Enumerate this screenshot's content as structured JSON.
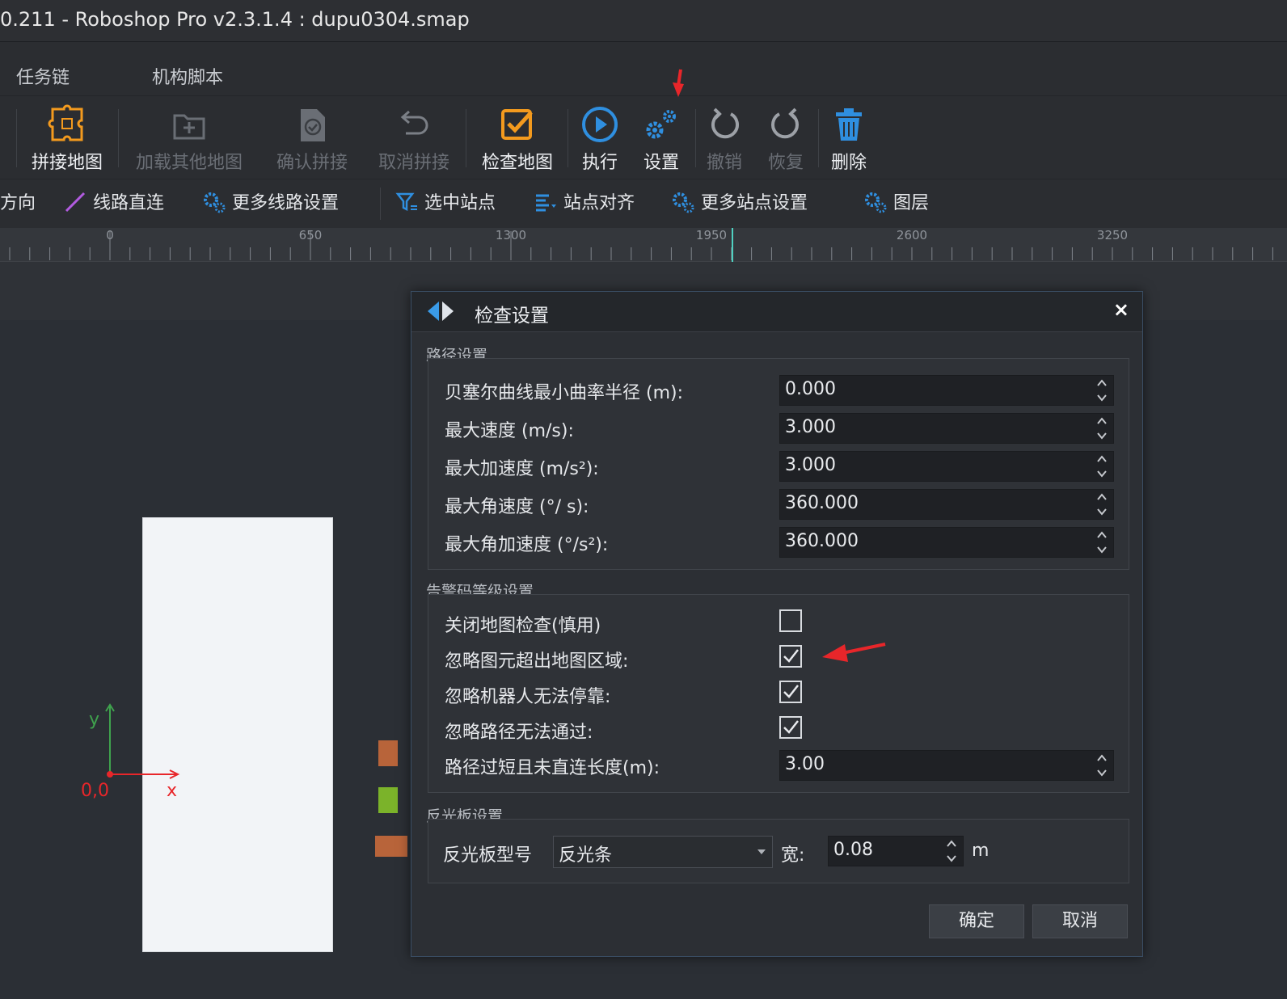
{
  "window": {
    "title": "0.211 - Roboshop Pro v2.3.1.4 : dupu0304.smap"
  },
  "menu": {
    "items": [
      "任务链",
      "机构脚本"
    ]
  },
  "toolbar": {
    "stitch_map": "拼接地图",
    "load_other": "加载其他地图",
    "confirm_stitch": "确认拼接",
    "cancel_stitch": "取消拼接",
    "check_map": "检查地图",
    "execute": "执行",
    "settings": "设置",
    "undo": "撤销",
    "redo": "恢复",
    "delete": "删除"
  },
  "subbar": {
    "direction": "方向",
    "line_direct": "线路直连",
    "more_line": "更多线路设置",
    "select_station": "选中站点",
    "align_station": "站点对齐",
    "more_station": "更多站点设置",
    "layers": "图层"
  },
  "ruler": {
    "ticks": [
      "0",
      "650",
      "1300",
      "1950",
      "2600",
      "3250"
    ]
  },
  "canvas": {
    "origin": "0,0",
    "x": "x",
    "y": "y"
  },
  "dialog": {
    "title": "检查设置",
    "close": "×",
    "path_group": {
      "title": "路径设置",
      "rows": [
        {
          "label": "贝塞尔曲线最小曲率半径 (m):",
          "value": "0.000"
        },
        {
          "label": "最大速度 (m/s):",
          "value": "3.000"
        },
        {
          "label": "最大加速度 (m/s²):",
          "value": "3.000"
        },
        {
          "label": "最大角速度 (°/ s):",
          "value": "360.000"
        },
        {
          "label": "最大角加速度 (°/s²):",
          "value": "360.000"
        }
      ]
    },
    "alarm_group": {
      "title": "告警码等级设置",
      "checks": [
        {
          "label": "关闭地图检查(慎用)",
          "checked": false
        },
        {
          "label": "忽略图元超出地图区域:",
          "checked": true
        },
        {
          "label": "忽略机器人无法停靠:",
          "checked": true
        },
        {
          "label": "忽略路径无法通过:",
          "checked": true
        }
      ],
      "length_row": {
        "label": "路径过短且未直连长度(m):",
        "value": "3.00"
      }
    },
    "reflector_group": {
      "title": "反光板设置",
      "model_label": "反光板型号",
      "model_value": "反光条",
      "width_label": "宽:",
      "width_value": "0.08",
      "unit": "m"
    },
    "ok": "确定",
    "cancel": "取消"
  },
  "colors": {
    "accent_blue": "#2f8fe0",
    "accent_orange": "#f39a1e",
    "annotation_red": "#e8262a"
  }
}
